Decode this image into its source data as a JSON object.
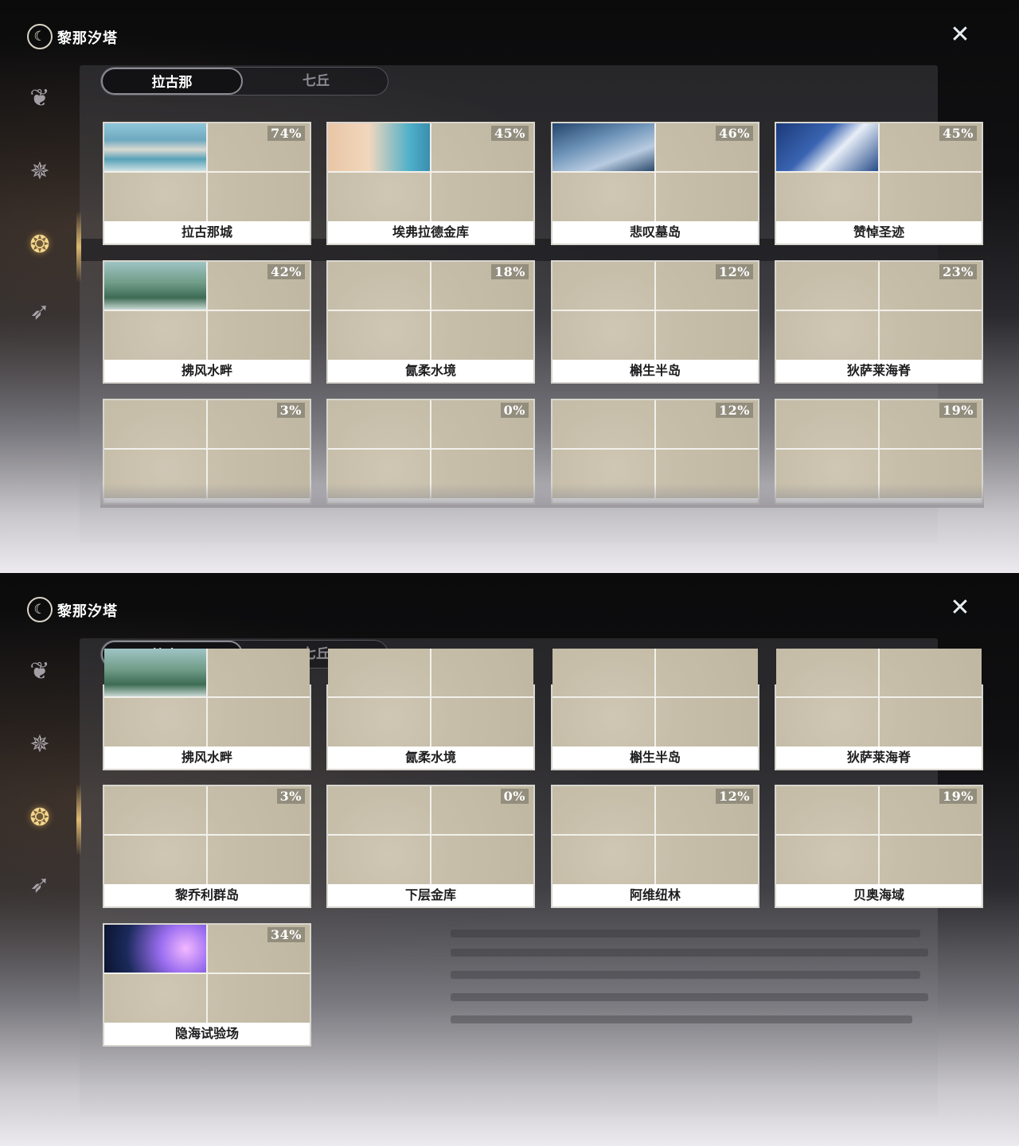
{
  "app": {
    "title": "黎那汐塔"
  },
  "tabs": [
    {
      "label": "拉古那",
      "active": true
    },
    {
      "label": "七丘",
      "active": false
    }
  ],
  "sidebar": {
    "items": [
      {
        "icon": "crest-icon",
        "active": false
      },
      {
        "icon": "star-emblem-icon",
        "active": false
      },
      {
        "icon": "region-emblem-icon",
        "active": true
      },
      {
        "icon": "wing-emblem-icon",
        "active": false
      }
    ]
  },
  "regions": [
    {
      "name": "拉古那城",
      "progress": "74%"
    },
    {
      "name": "埃弗拉德金库",
      "progress": "45%"
    },
    {
      "name": "悲叹墓岛",
      "progress": "46%"
    },
    {
      "name": "赞悼圣迹",
      "progress": "45%"
    },
    {
      "name": "拂风水畔",
      "progress": "42%"
    },
    {
      "name": "氤柔水境",
      "progress": "18%"
    },
    {
      "name": "槲生半岛",
      "progress": "12%"
    },
    {
      "name": "狄萨莱海脊",
      "progress": "23%"
    },
    {
      "name": "黎乔利群岛",
      "progress": "3%"
    },
    {
      "name": "下层金库",
      "progress": "0%"
    },
    {
      "name": "阿维纽林",
      "progress": "12%"
    },
    {
      "name": "贝奥海域",
      "progress": "19%"
    },
    {
      "name": "隐海试验场",
      "progress": "34%"
    }
  ]
}
